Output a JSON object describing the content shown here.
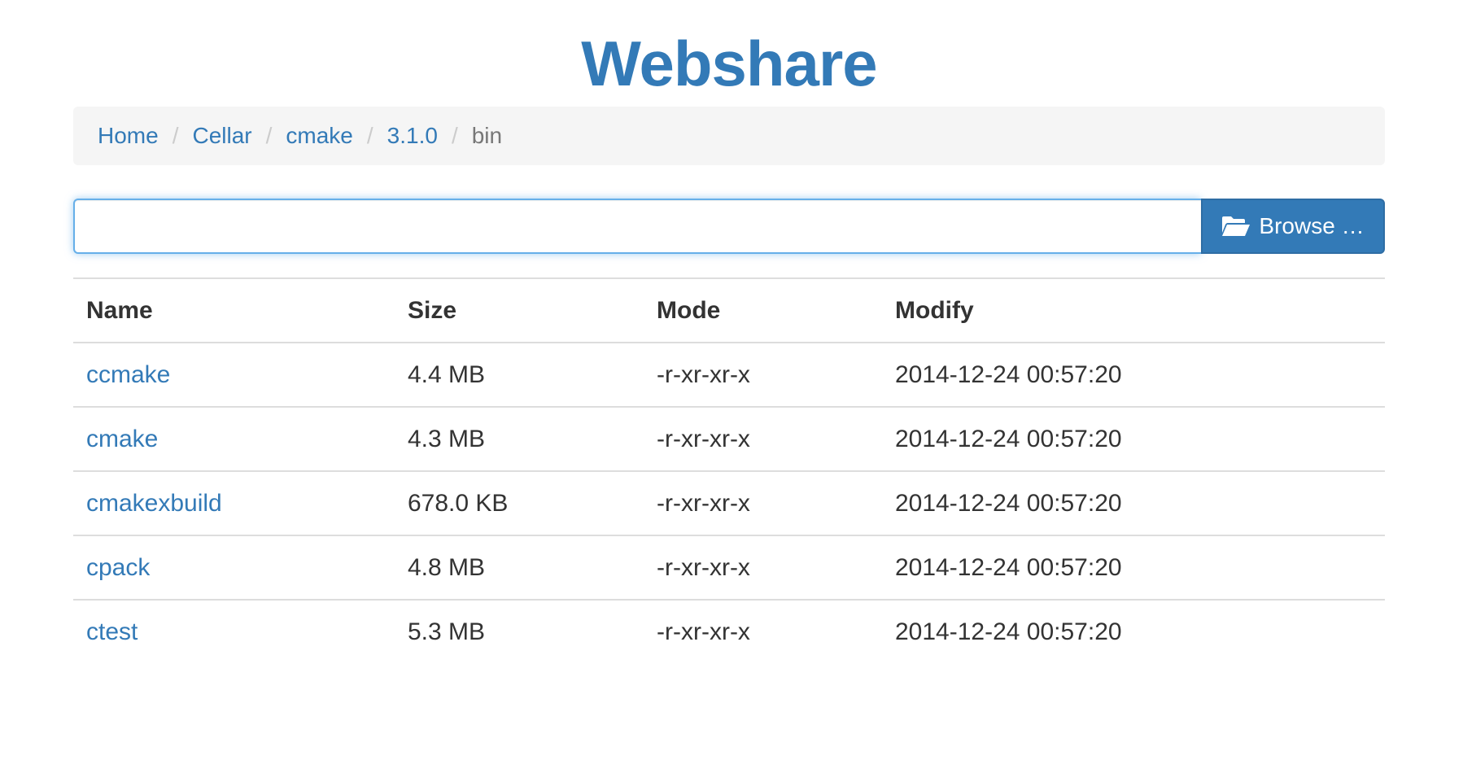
{
  "header": {
    "title": "Webshare"
  },
  "breadcrumb": {
    "items": [
      {
        "label": "Home"
      },
      {
        "label": "Cellar"
      },
      {
        "label": "cmake"
      },
      {
        "label": "3.1.0"
      }
    ],
    "separator": "/",
    "current": "bin"
  },
  "upload": {
    "value": "",
    "placeholder": "",
    "browse_label": "Browse …",
    "browse_icon": "folder-open-icon"
  },
  "table": {
    "headers": [
      "Name",
      "Size",
      "Mode",
      "Modify"
    ],
    "rows": [
      {
        "name": "ccmake",
        "size": "4.4 MB",
        "mode": "-r-xr-xr-x",
        "modify": "2014-12-24 00:57:20"
      },
      {
        "name": "cmake",
        "size": "4.3 MB",
        "mode": "-r-xr-xr-x",
        "modify": "2014-12-24 00:57:20"
      },
      {
        "name": "cmakexbuild",
        "size": "678.0 KB",
        "mode": "-r-xr-xr-x",
        "modify": "2014-12-24 00:57:20"
      },
      {
        "name": "cpack",
        "size": "4.8 MB",
        "mode": "-r-xr-xr-x",
        "modify": "2014-12-24 00:57:20"
      },
      {
        "name": "ctest",
        "size": "5.3 MB",
        "mode": "-r-xr-xr-x",
        "modify": "2014-12-24 00:57:20"
      }
    ]
  },
  "colors": {
    "brand": "#337ab7",
    "breadcrumb_bg": "#f5f5f5",
    "border": "#dddddd",
    "focus": "#66afe9"
  }
}
